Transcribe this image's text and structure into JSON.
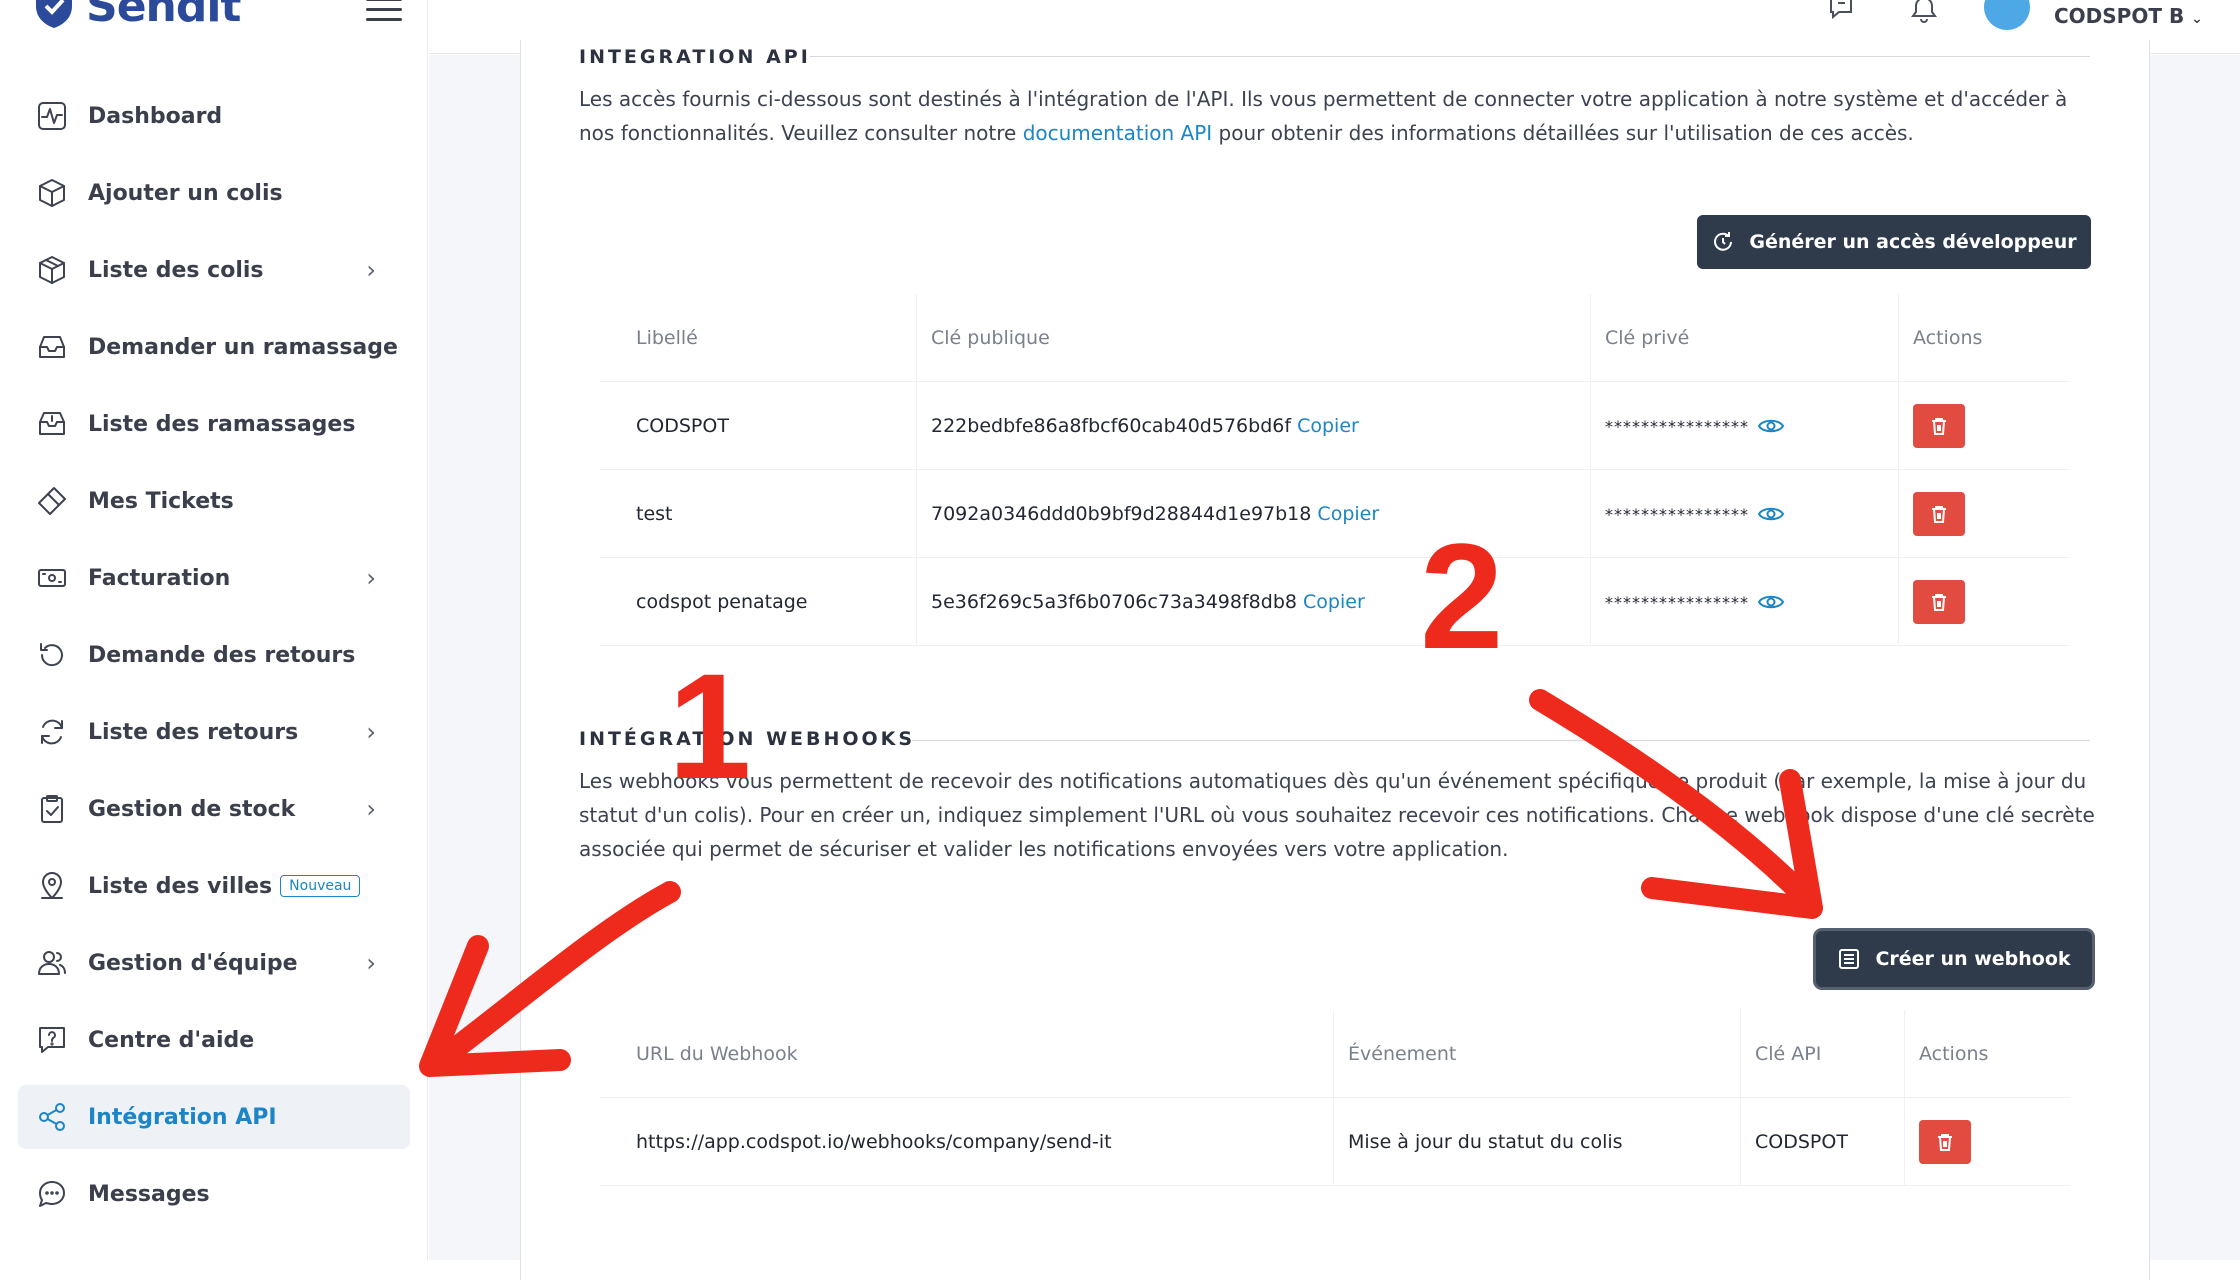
{
  "sidebar": {
    "brand": "Sendit",
    "items": [
      {
        "label": "Dashboard",
        "icon": "pulse-icon",
        "chevron": false
      },
      {
        "label": "Ajouter un colis",
        "icon": "box-icon",
        "chevron": false
      },
      {
        "label": "Liste des colis",
        "icon": "package-icon",
        "chevron": true
      },
      {
        "label": "Demander un ramassage",
        "icon": "inbox-icon",
        "chevron": false
      },
      {
        "label": "Liste des ramassages",
        "icon": "tray-icon",
        "chevron": false
      },
      {
        "label": "Mes Tickets",
        "icon": "ticket-icon",
        "chevron": false
      },
      {
        "label": "Facturation",
        "icon": "bill-icon",
        "chevron": true
      },
      {
        "label": "Demande des retours",
        "icon": "undo-icon",
        "chevron": false
      },
      {
        "label": "Liste des retours",
        "icon": "refresh-icon",
        "chevron": true
      },
      {
        "label": "Gestion de stock",
        "icon": "clipboard-icon",
        "chevron": true
      },
      {
        "label": "Liste des villes",
        "icon": "location-icon",
        "chevron": false,
        "badge": "Nouveau"
      },
      {
        "label": "Gestion d'équipe",
        "icon": "team-icon",
        "chevron": true
      },
      {
        "label": "Centre d'aide",
        "icon": "help-icon",
        "chevron": false
      },
      {
        "label": "Intégration API",
        "icon": "share-icon",
        "chevron": false,
        "active": true
      },
      {
        "label": "Messages",
        "icon": "chat-icon",
        "chevron": false
      }
    ]
  },
  "topbar": {
    "user_name": "CODSPOT B"
  },
  "api_section": {
    "title": "INTEGRATION API",
    "description_part1": "Les accès fournis ci-dessous sont destinés à l'intégration de l'API. Ils vous permettent de connecter votre application à notre système et d'accéder à nos fonctionnalités. Veuillez consulter notre ",
    "doc_link": "documentation API",
    "description_part2": " pour obtenir des informations détaillées sur l'utilisation de ces accès.",
    "generate_button": "Générer un accès développeur",
    "columns": [
      "Libellé",
      "Clé publique",
      "Clé privé",
      "Actions"
    ],
    "copy_label": "Copier",
    "masked": "****************",
    "rows": [
      {
        "label": "CODSPOT",
        "public_key": "222bedbfe86a8fbcf60cab40d576bd6f"
      },
      {
        "label": "test",
        "public_key": "7092a0346ddd0b9bf9d28844d1e97b18"
      },
      {
        "label": "codspot penatage",
        "public_key": "5e36f269c5a3f6b0706c73a3498f8db8"
      }
    ]
  },
  "webhooks_section": {
    "title": "INTÉGRATION WEBHOOKS",
    "description": "Les webhooks vous permettent de recevoir des notifications automatiques dès qu'un événement spécifique se produit (par exemple, la mise à jour du statut d'un colis). Pour en créer un, indiquez simplement l'URL où vous souhaitez recevoir ces notifications. Chaque webhook dispose d'une clé secrète associée qui permet de sécuriser et valider les notifications envoyées vers votre application.",
    "create_button": "Créer un webhook",
    "columns": [
      "URL du Webhook",
      "Événement",
      "Clé API",
      "Actions"
    ],
    "rows": [
      {
        "url": "https://app.codspot.io/webhooks/company/send-it",
        "event": "Mise à jour du statut du colis",
        "api_key": "CODSPOT"
      }
    ]
  },
  "annotations": {
    "step1": "1",
    "step2": "2",
    "color": "#ee2a1d"
  }
}
